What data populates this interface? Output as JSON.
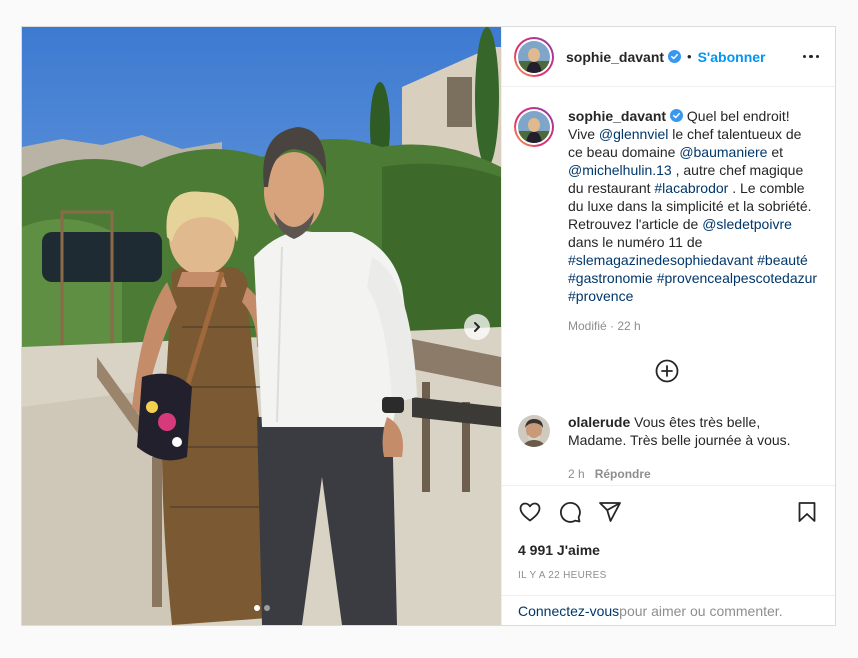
{
  "post": {
    "username": "sophie_davant",
    "verified": true,
    "separator": "•",
    "follow_label": "S'abonner",
    "more_icon": "more-horizontal-icon",
    "media": {
      "carousel_pages": 2,
      "current_page": 1,
      "next_icon": "chevron-right-icon"
    },
    "caption": {
      "username": "sophie_davant",
      "parts": [
        {
          "t": "text",
          "v": " Quel bel endroit! Vive "
        },
        {
          "t": "link",
          "v": "@glennviel"
        },
        {
          "t": "text",
          "v": " le chef talentueux de ce beau domaine "
        },
        {
          "t": "link",
          "v": "@baumaniere"
        },
        {
          "t": "text",
          "v": " et "
        },
        {
          "t": "link",
          "v": "@michelhulin.13"
        },
        {
          "t": "text",
          "v": " , autre chef magique du restaurant "
        },
        {
          "t": "link",
          "v": "#lacabrodor"
        },
        {
          "t": "text",
          "v": " . Le comble du luxe dans la simplicité et la sobriété. Retrouvez l'article de "
        },
        {
          "t": "link",
          "v": "@sledetpoivre"
        },
        {
          "t": "text",
          "v": " dans le numéro 11 de "
        },
        {
          "t": "link",
          "v": "#slemagazinedesophiedavant"
        },
        {
          "t": "text",
          "v": " "
        },
        {
          "t": "link",
          "v": "#beauté"
        },
        {
          "t": "text",
          "v": " "
        },
        {
          "t": "link",
          "v": "#gastronomie"
        },
        {
          "t": "text",
          "v": " "
        },
        {
          "t": "link",
          "v": "#provencealpescotedazur"
        },
        {
          "t": "text",
          "v": " "
        },
        {
          "t": "link",
          "v": "#provence"
        }
      ],
      "meta": "Modifié · 22 h"
    },
    "load_more_icon": "plus-circle-icon",
    "comment": {
      "username": "olalerude",
      "text": " Vous êtes très belle, Madame. Très belle journée à vous.",
      "time": "2 h",
      "reply_label": "Répondre"
    },
    "actions": {
      "like_icon": "heart-icon",
      "comment_icon": "comment-icon",
      "share_icon": "share-icon",
      "save_icon": "bookmark-icon"
    },
    "likes": "4 991 J'aime",
    "timestamp": "IL Y A 22 HEURES",
    "login": {
      "cta": "Connectez-vous",
      "rest": " pour aimer ou commenter."
    },
    "colors": {
      "accent": "#0095f6",
      "link": "#00376b",
      "muted": "#8e8e8e",
      "border": "#dbdbdb"
    }
  }
}
